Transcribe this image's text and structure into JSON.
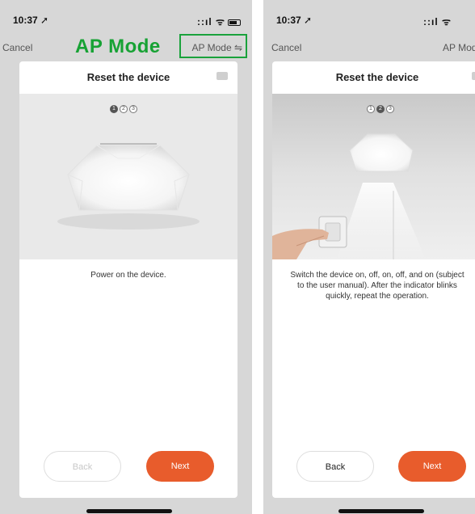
{
  "left": {
    "status": {
      "time": "10:37 ➚",
      "icons": "::ıl ᯤ"
    },
    "nav": {
      "cancel": "Cancel",
      "mode": "AP Mode ⇋"
    },
    "overlay_label": "AP Mode",
    "card": {
      "title": "Reset the device",
      "steps": [
        "1",
        "2",
        "3"
      ],
      "active_step": 1,
      "description": "Power on the device.",
      "back_label": "Back",
      "next_label": "Next"
    }
  },
  "right": {
    "status": {
      "time": "10:37 ➚",
      "icons": "::ıl ᯤ"
    },
    "nav": {
      "cancel": "Cancel",
      "mode": "AP Mod"
    },
    "card": {
      "title": "Reset the device",
      "steps": [
        "1",
        "2",
        "3"
      ],
      "active_step": 2,
      "description": "Switch the device on, off, on, off, and on (subject to the user manual). After the indicator blinks quickly, repeat the operation.",
      "back_label": "Back",
      "next_label": "Next"
    }
  },
  "colors": {
    "accent": "#e85c2c",
    "highlight": "#1aa23c",
    "background": "#d7d7d7"
  }
}
